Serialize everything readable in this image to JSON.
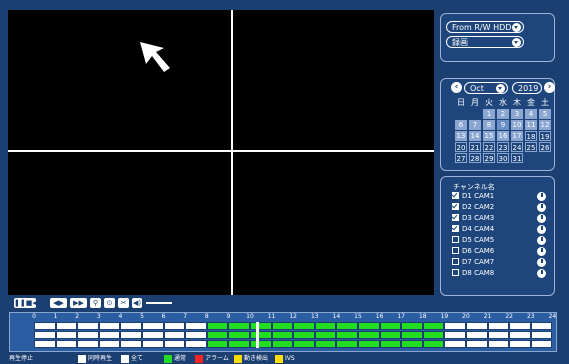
{
  "source": {
    "value": "From R/W HDD"
  },
  "mode": {
    "value": "録画"
  },
  "calendar": {
    "month": "Oct",
    "year": "2019",
    "weekdays": [
      "日",
      "月",
      "火",
      "水",
      "木",
      "金",
      "土"
    ],
    "weeks": [
      [
        "",
        "",
        "1",
        "2",
        "3",
        "4",
        "5"
      ],
      [
        "6",
        "7",
        "8",
        "9",
        "10",
        "11",
        "12"
      ],
      [
        "13",
        "14",
        "15",
        "16",
        "17",
        "18",
        "19"
      ],
      [
        "20",
        "21",
        "22",
        "23",
        "24",
        "25",
        "26"
      ],
      [
        "27",
        "28",
        "29",
        "30",
        "31",
        "",
        ""
      ]
    ],
    "recorded_days": [
      1,
      2,
      3,
      4,
      5,
      6,
      7,
      8,
      9,
      10,
      11,
      12,
      13,
      14,
      15,
      16,
      17
    ],
    "selected_day": 9
  },
  "channels": {
    "header": "チャンネル名",
    "items": [
      {
        "label": "D1 CAM1",
        "checked": true
      },
      {
        "label": "D2 CAM2",
        "checked": true
      },
      {
        "label": "D3 CAM3",
        "checked": true
      },
      {
        "label": "D4 CAM4",
        "checked": true
      },
      {
        "label": "D5 CAM5",
        "checked": false
      },
      {
        "label": "D6 CAM6",
        "checked": false
      },
      {
        "label": "D7 CAM7",
        "checked": false
      },
      {
        "label": "D8 CAM8",
        "checked": false
      }
    ]
  },
  "timeline": {
    "hours": [
      "0",
      "1",
      "2",
      "3",
      "4",
      "5",
      "6",
      "7",
      "8",
      "9",
      "10",
      "11",
      "12",
      "13",
      "14",
      "15",
      "16",
      "17",
      "18",
      "19",
      "20",
      "21",
      "22",
      "23",
      "24"
    ],
    "recorded_from_hour": 8,
    "recorded_to_hour": 19
  },
  "status": {
    "stop_label": "再生停止",
    "sync_label": "同時再生",
    "all_label": "全て",
    "normal_label": "通常",
    "alarm_label": "アラーム",
    "motion_label": "動き検出",
    "ivs_label": "IVS"
  },
  "colors": {
    "normal": "#22dd22",
    "alarm": "#ff2222",
    "motion": "#ffdd00",
    "ivs": "#ffdd00"
  }
}
